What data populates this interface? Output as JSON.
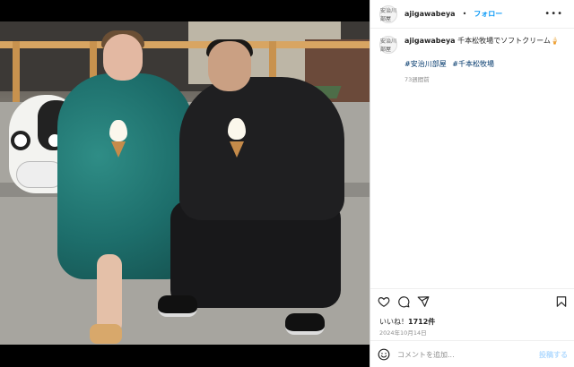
{
  "post": {
    "username": "ajigawabeya",
    "separator": "•",
    "follow_label": "フォロー",
    "avatar_text": "安治川部屋",
    "more_icon": "more-horizontal-icon",
    "caption_user": "ajigawabeya",
    "caption_text": "千本松牧場でソフトクリーム🍦",
    "hashtags": [
      "#安治川部屋",
      "#千本松牧場"
    ],
    "time_ago": "73週間前",
    "likes_prefix": "いいね！",
    "likes_count": "1712件",
    "date": "2024年10月14日",
    "comment_placeholder": "コメントを追加...",
    "post_button": "投稿する"
  },
  "icons": {
    "like": "heart-icon",
    "comment": "comment-icon",
    "share": "share-icon",
    "save": "bookmark-icon",
    "emoji": "emoji-icon"
  },
  "colors": {
    "link_blue": "#0095f6",
    "hashtag_blue": "#00376b",
    "muted_gray": "#8e8e8e",
    "text_dark": "#262626"
  }
}
